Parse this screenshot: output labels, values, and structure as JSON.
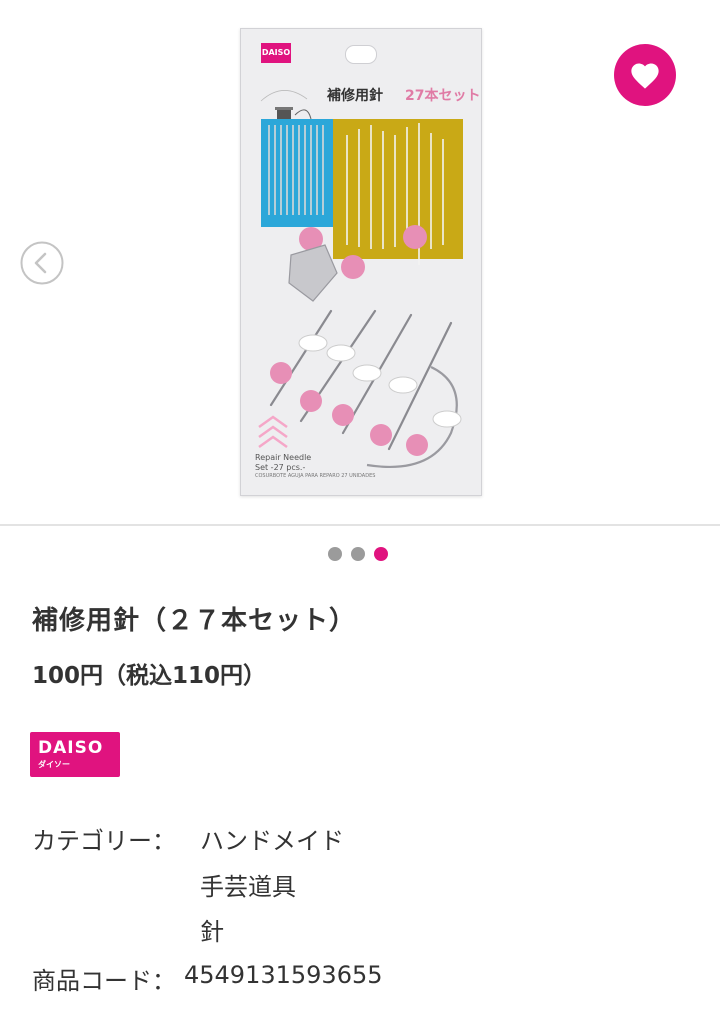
{
  "product_image": {
    "package_brand": "DAISO",
    "package_deco_text": "Hand Made",
    "package_name": "補修用針",
    "package_count": "27本セット",
    "package_caption_line1": "Repair Needle",
    "package_caption_line2": "Set -27 pcs.-",
    "package_small_print": "COSURBOTE AGUJA PARA REPARO 27 UNIDADES"
  },
  "carousel": {
    "dot_count": 3,
    "active_index": 2
  },
  "product": {
    "title": "補修用針（２７本セット）",
    "price": "100円（税込110円）"
  },
  "brand": {
    "logo_text": "DAISO",
    "logo_subtext": "ダイソー"
  },
  "details": {
    "category_label": "カテゴリー：",
    "categories": [
      "ハンドメイド",
      "手芸道具",
      "針"
    ],
    "code_label": "商品コード：",
    "code_value": "4549131593655"
  },
  "colors": {
    "accent": "#e0137f",
    "text": "#333333",
    "dot_inactive": "#9b9b9b"
  },
  "icons": {
    "favorite": "heart-icon",
    "previous": "chevron-left-icon"
  }
}
